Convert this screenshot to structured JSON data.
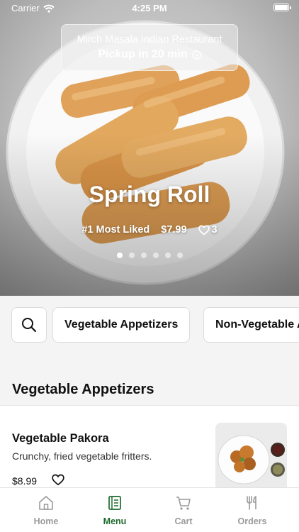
{
  "status_bar": {
    "carrier": "Carrier",
    "time": "4:25 PM"
  },
  "restaurant": {
    "name": "Mirch Masala Indian Restaurant",
    "pickup": "Pickup in 20 min"
  },
  "featured": {
    "title": "Spring Roll",
    "rank": "#1 Most Liked",
    "price": "$7.99",
    "likes": "3",
    "pages": 6,
    "active_page": 1
  },
  "categories": {
    "search_icon": "search-icon",
    "chips": [
      "Vegetable Appetizers",
      "Non-Vegetable Appetizers"
    ]
  },
  "section": {
    "title": "Vegetable Appetizers"
  },
  "items": [
    {
      "name": "Vegetable Pakora",
      "description": "Crunchy, fried vegetable fritters.",
      "price": "$8.99"
    }
  ],
  "tabs": [
    {
      "label": "Home",
      "icon": "home-icon",
      "active": false
    },
    {
      "label": "Menu",
      "icon": "menu-icon",
      "active": true
    },
    {
      "label": "Cart",
      "icon": "cart-icon",
      "active": false
    },
    {
      "label": "Orders",
      "icon": "fork-knife-icon",
      "active": false
    }
  ],
  "colors": {
    "accent": "#1d6b2e",
    "inactive_tab": "#9a9a9a"
  }
}
